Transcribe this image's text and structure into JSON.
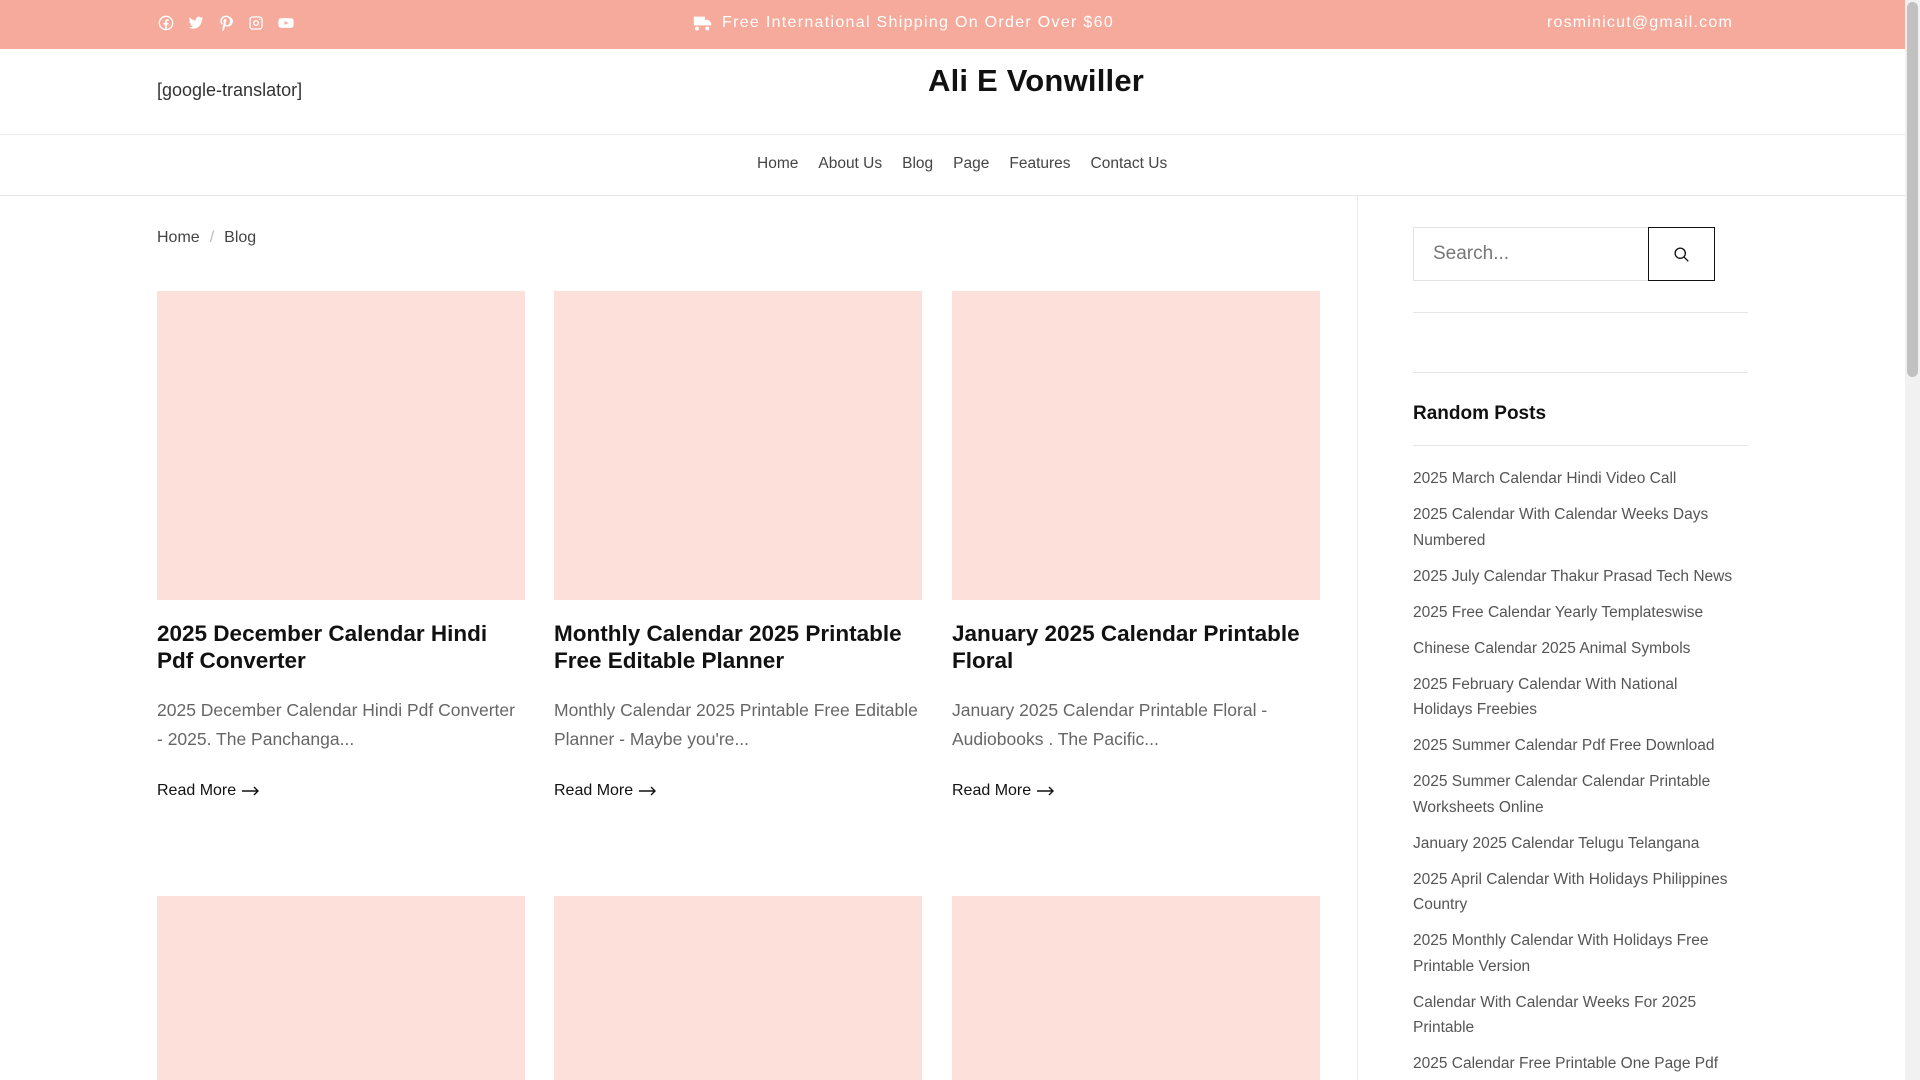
{
  "topbar": {
    "social_icons": [
      "facebook-icon",
      "twitter-icon",
      "pinterest-icon",
      "instagram-icon",
      "youtube-icon"
    ],
    "shipping_text": "Free International Shipping On Order Over $60",
    "email": "rosminicut@gmail.com",
    "background": "#f6aa9b"
  },
  "header": {
    "translator": "[google-translator]",
    "site_title": "Ali E Vonwiller"
  },
  "nav": {
    "items": [
      "Home",
      "About Us",
      "Blog",
      "Page",
      "Features",
      "Contact Us"
    ]
  },
  "breadcrumb": {
    "home": "Home",
    "separator": "/",
    "current": "Blog"
  },
  "posts": [
    {
      "title": "2025 December Calendar Hindi Pdf Converter",
      "excerpt": "2025 December Calendar Hindi Pdf Converter - 2025. The Panchanga...",
      "read_more": "Read More"
    },
    {
      "title": "Monthly Calendar 2025 Printable Free Editable Planner",
      "excerpt": "Monthly Calendar 2025 Printable Free Editable Planner - Maybe you're...",
      "read_more": "Read More"
    },
    {
      "title": "January 2025 Calendar Printable Floral",
      "excerpt": "January 2025 Calendar Printable Floral - Audiobooks . The Pacific...",
      "read_more": "Read More"
    }
  ],
  "sidebar": {
    "search_placeholder": "Search...",
    "random_title": "Random Posts",
    "random_posts": [
      "2025 March Calendar Hindi Video Call",
      "2025 Calendar With Calendar Weeks Days Numbered",
      "2025 July Calendar Thakur Prasad Tech News",
      "2025 Free Calendar Yearly Templateswise",
      "Chinese Calendar 2025 Animal Symbols",
      "2025 February Calendar With National Holidays Freebies",
      "2025 Summer Calendar Pdf Free Download",
      "2025 Summer Calendar Calendar Printable Worksheets Online",
      "January 2025 Calendar Telugu Telangana",
      "2025 April Calendar With Holidays Philippines Country",
      "2025 Monthly Calendar With Holidays Free Printable Version",
      "Calendar With Calendar Weeks For 2025 Printable",
      "2025 Calendar Free Printable One Page Pdf"
    ]
  },
  "colors": {
    "accent": "#f6aa9b",
    "thumb_placeholder": "#fde0da"
  }
}
